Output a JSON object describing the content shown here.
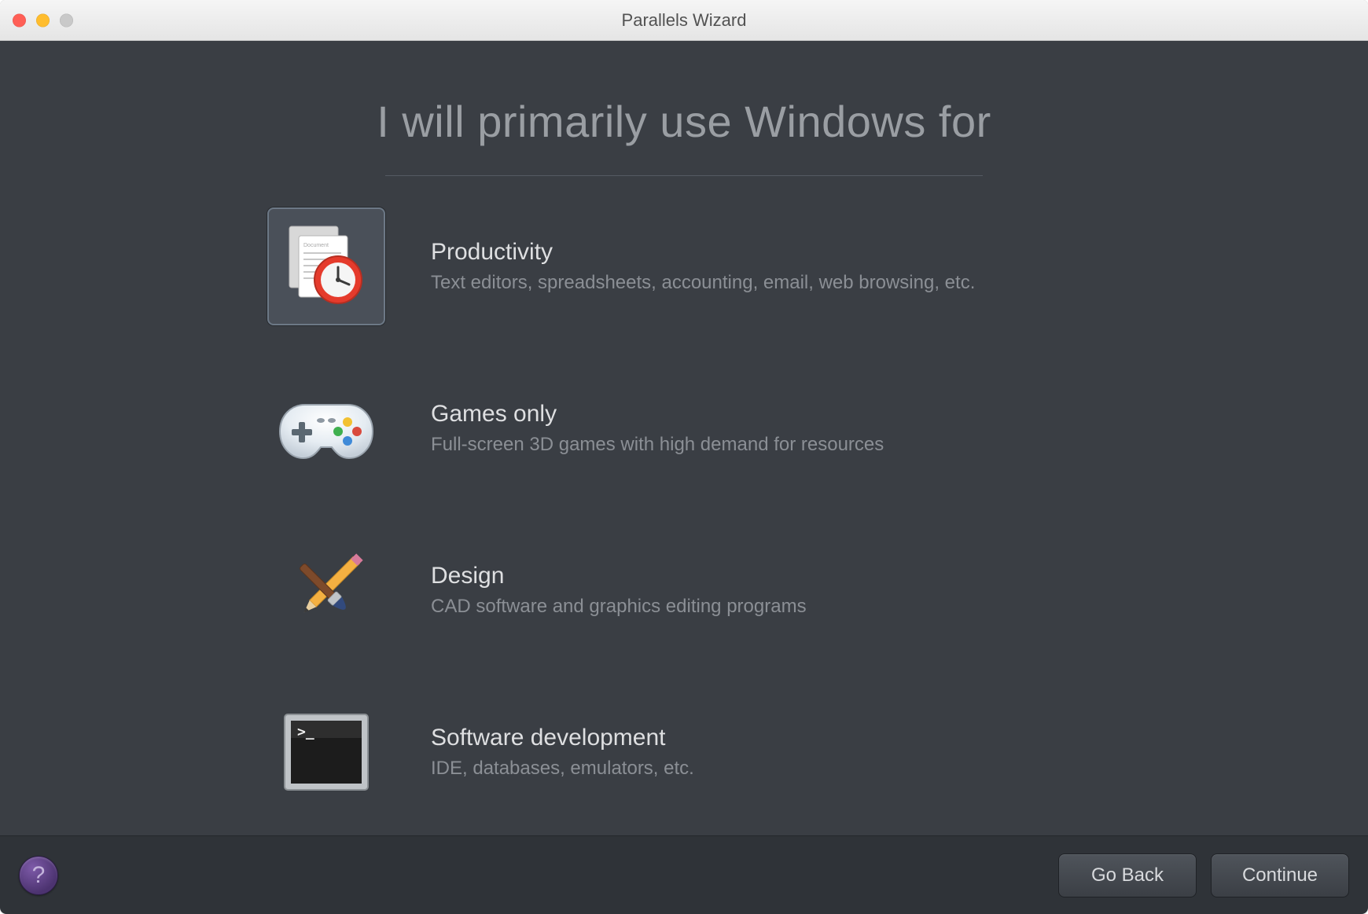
{
  "window": {
    "title": "Parallels Wizard"
  },
  "heading": "I will primarily use Windows for",
  "options": [
    {
      "id": "productivity",
      "title": "Productivity",
      "desc": "Text editors, spreadsheets, accounting, email, web browsing, etc.",
      "icon": "document-clock-icon",
      "selected": true
    },
    {
      "id": "games",
      "title": "Games only",
      "desc": "Full-screen 3D games with high demand for resources",
      "icon": "game-controller-icon",
      "selected": false
    },
    {
      "id": "design",
      "title": "Design",
      "desc": "CAD software and graphics editing programs",
      "icon": "brush-pencil-icon",
      "selected": false
    },
    {
      "id": "devel",
      "title": "Software development",
      "desc": "IDE, databases, emulators, etc.",
      "icon": "terminal-icon",
      "selected": false
    }
  ],
  "footer": {
    "help_tooltip": "?",
    "back_label": "Go Back",
    "continue_label": "Continue"
  }
}
